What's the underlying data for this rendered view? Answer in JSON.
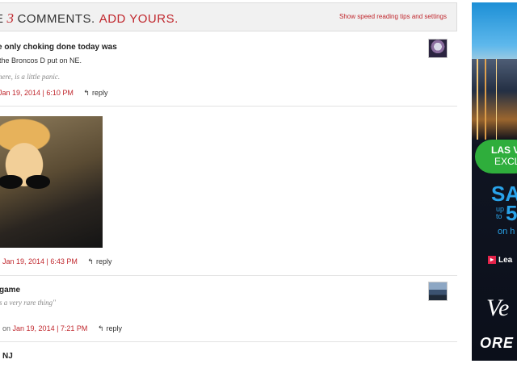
{
  "header": {
    "prefix": "E",
    "count": "3",
    "comments_label": "COMMENTS.",
    "add_label": "ADD YOURS.",
    "tips_link": "Show speed reading tips and settings"
  },
  "comments": [
    {
      "name": "e only choking done today was",
      "text": "the Broncos D put on NE.",
      "quote": "here, is a little panic.",
      "date": "Jan 19, 2014 | 6:10 PM",
      "reply": "reply"
    },
    {
      "date": "Jan 19, 2014 | 6:43 PM",
      "reply": "reply"
    },
    {
      "name": "game",
      "quote": "s a very rare thing\"",
      "by": "on",
      "date": "Jan 19, 2014 | 7:21 PM",
      "reply": "reply"
    },
    {
      "name": "NJ"
    }
  ],
  "ad": {
    "line1": "LAS V",
    "line2": "EXCL",
    "sale": "SA",
    "upto": "up",
    "to": "to",
    "big_number": "5",
    "on": "on h",
    "learn": "Lea",
    "script_word": "Ve",
    "brand": "ORE"
  },
  "colors": {
    "accent": "#c0272d",
    "header_bg": "#f1f1f1"
  }
}
